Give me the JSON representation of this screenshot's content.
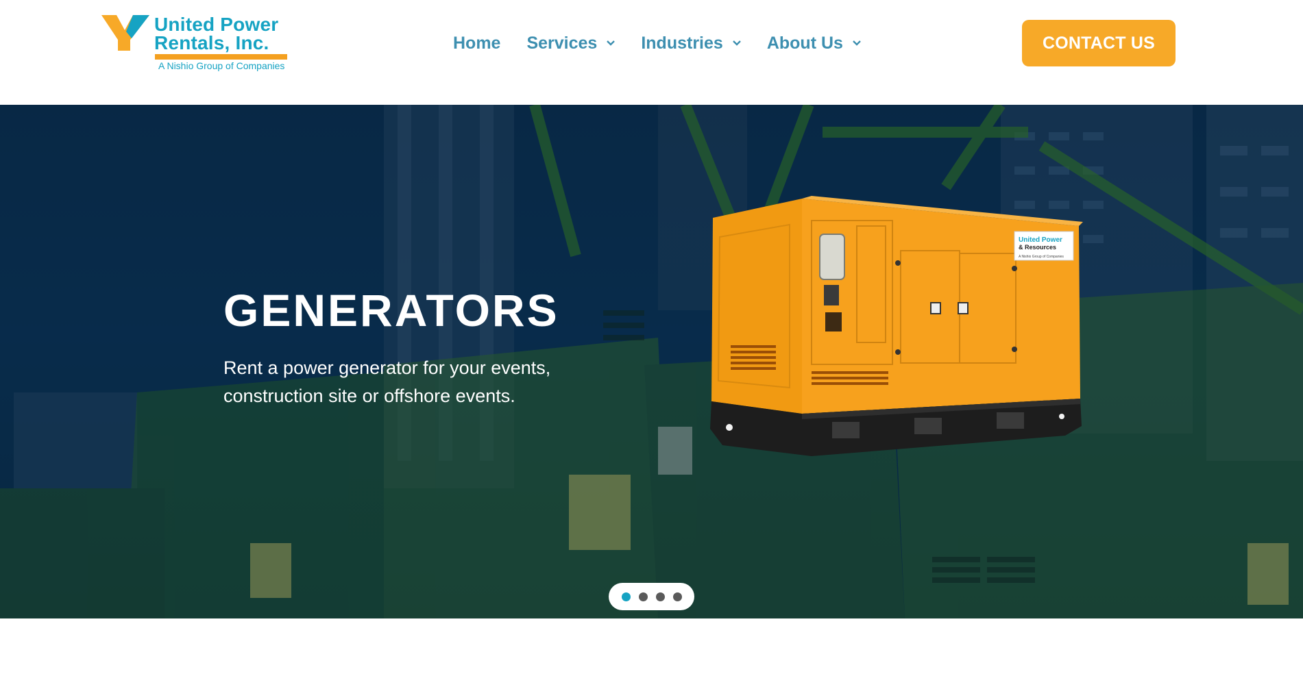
{
  "header": {
    "logo": {
      "title_line1": "United Power",
      "title_line2": "Rentals, Inc.",
      "subtitle": "A Nishio Group of Companies"
    },
    "nav": [
      {
        "label": "Home",
        "has_dropdown": false
      },
      {
        "label": "Services",
        "has_dropdown": true
      },
      {
        "label": "Industries",
        "has_dropdown": true
      },
      {
        "label": "About Us",
        "has_dropdown": true
      }
    ],
    "contact_label": "CONTACT US"
  },
  "hero": {
    "title": "GENERATORS",
    "text_line1": "Rent a power generator for your events,",
    "text_line2": "construction site or offshore events.",
    "generator_label_line1": "United Power",
    "generator_label_line2": "& Resources",
    "generator_label_line3": "A Nishio Group of Companies"
  },
  "slider": {
    "slide_count": 4,
    "active_index": 0
  },
  "colors": {
    "brand_blue": "#16a3c3",
    "nav_blue": "#3d8fb0",
    "brand_orange": "#f7a928",
    "hero_dark": "#0b3456",
    "machinery_green": "#3d8a1e"
  }
}
